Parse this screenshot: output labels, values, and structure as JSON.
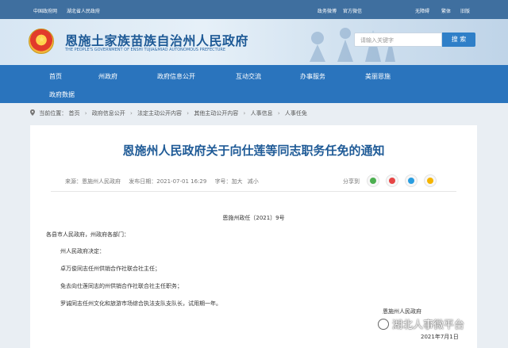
{
  "topbar": {
    "left_links": [
      "中国政府网",
      "湖北省人民政府"
    ],
    "right_links": [
      "政务微博",
      "官方微信",
      "无障碍",
      "繁体",
      "旧版"
    ]
  },
  "header": {
    "site_title": "恩施土家族苗族自治州人民政府",
    "site_subtitle": "THE PEOPLE'S GOVERNMENT OF ENSHI TUJIA&MIAO AUTONOMOUS PREFECTURE",
    "search_placeholder": "请输入关键字",
    "search_button": "搜 索"
  },
  "nav": {
    "items": [
      "首页",
      "州政府",
      "政府信息公开",
      "互动交流",
      "办事服务",
      "美丽恩施",
      "政府数据"
    ]
  },
  "breadcrumb": {
    "label": "当前位置：",
    "items": [
      "首页",
      "政府信息公开",
      "法定主动公开内容",
      "其他主动公开内容",
      "人事信息",
      "人事任免"
    ]
  },
  "article": {
    "title": "恩施州人民政府关于向仕莲等同志职务任免的通知",
    "source_label": "来源：",
    "source": "恩施州人民政府",
    "publish_label": "发布日期：",
    "publish_time": "2021-07-01 16:29",
    "font_label": "字号：",
    "font_larger": "加大",
    "font_smaller": "减小",
    "share_label": "分享到",
    "doc_number": "恩施州政任〔2021〕9号",
    "salutation": "各县市人民政府，州政府各部门：",
    "paragraphs": [
      "州人民政府决定：",
      "卓万俊同志任州供销合作社联合社主任；",
      "免去向仕莲同志的州供销合作社联合社主任职务；",
      "罗诚同志任州文化和旅游市场综合执法支队支队长，试用期一年。"
    ],
    "signature": "恩施州人民政府",
    "date": "2021年7月1日"
  },
  "watermark": "湖北人事微平台",
  "colors": {
    "topbar": "#3f6f9f",
    "nav": "#2a74bd",
    "title": "#1e5a96",
    "accent_button": "#2f7fc8"
  }
}
